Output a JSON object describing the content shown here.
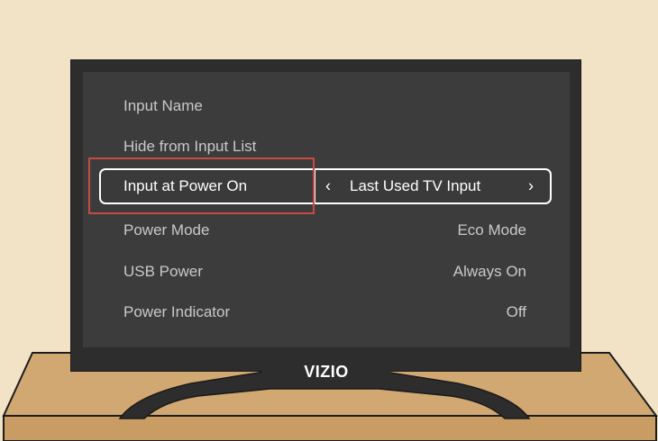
{
  "tv": {
    "brand": "VIZIO"
  },
  "menu": {
    "rows": [
      {
        "label": "Input Name",
        "value": ""
      },
      {
        "label": "Hide from Input List",
        "value": ""
      },
      {
        "label": "Input at Power On",
        "value": "Last Used TV Input",
        "selected": true
      },
      {
        "label": "Power Mode",
        "value": "Eco Mode"
      },
      {
        "label": "USB Power",
        "value": "Always On"
      },
      {
        "label": "Power Indicator",
        "value": "Off"
      }
    ],
    "arrow_left": "‹",
    "arrow_right": "›"
  },
  "colors": {
    "background": "#f2e3c6",
    "table": "#d2a872",
    "bezel": "#2d2d2d",
    "screen": "#3c3c3c",
    "text": "#c9c9c9",
    "selected": "#ffffff",
    "highlight": "#c64b43"
  }
}
